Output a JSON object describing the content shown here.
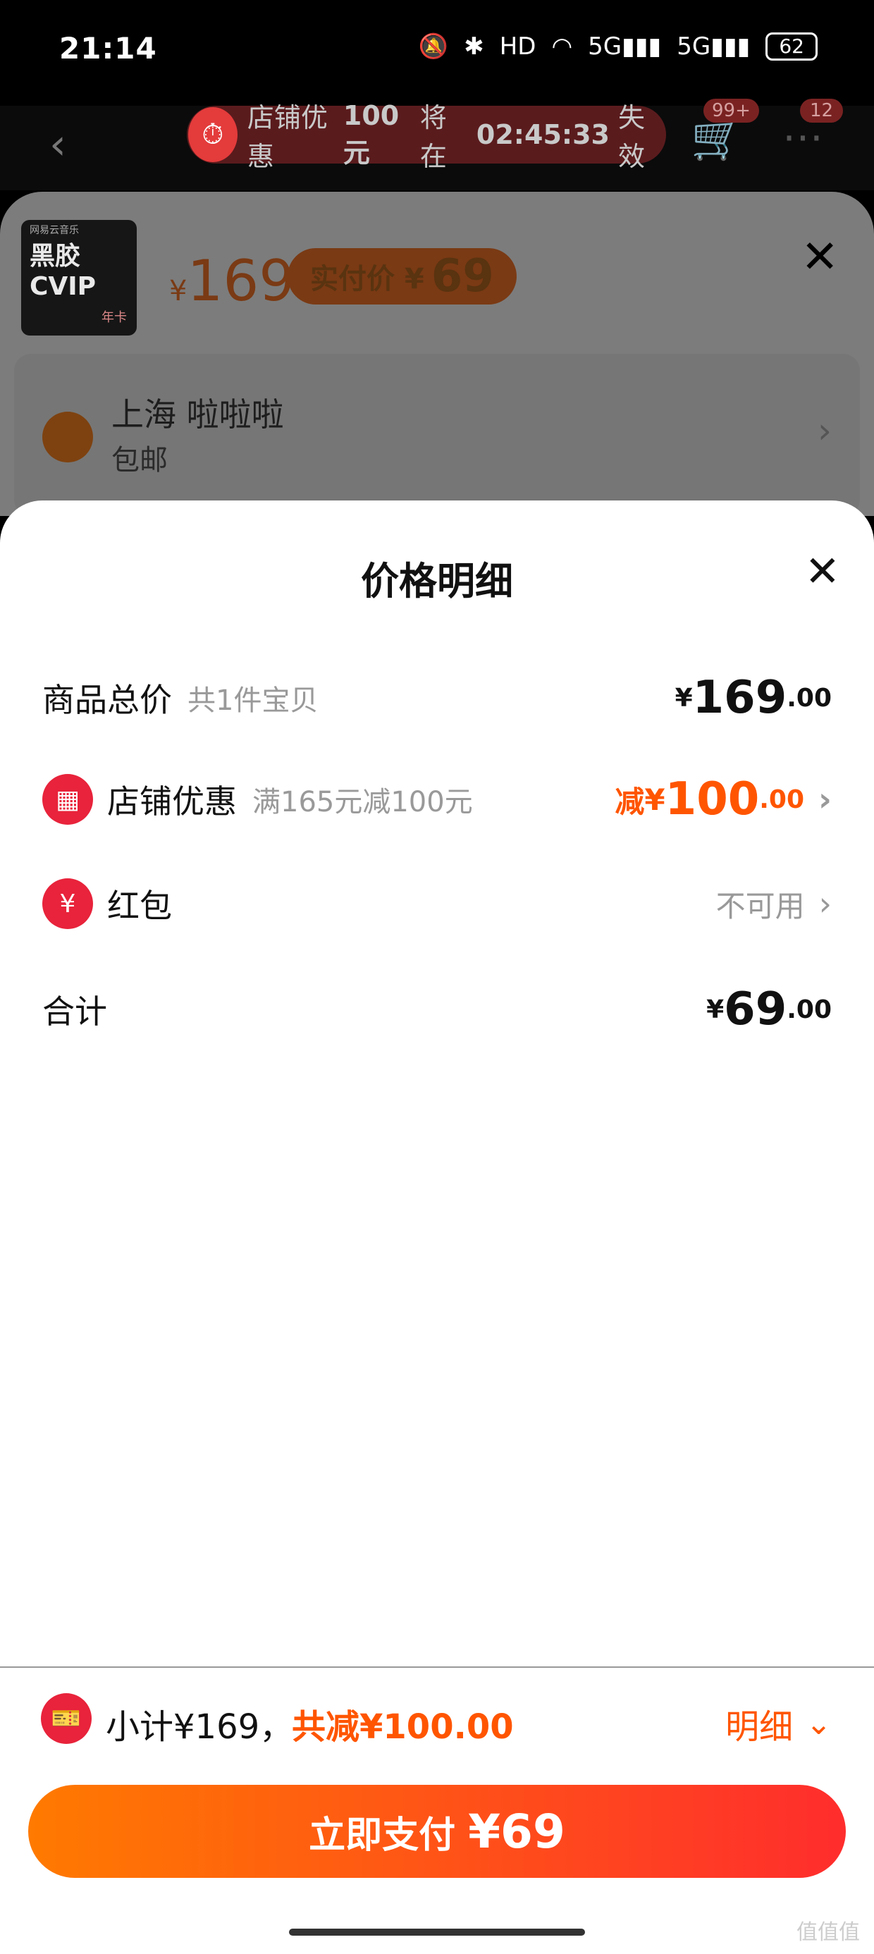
{
  "status_bar": {
    "time": "21:14",
    "battery": "62"
  },
  "top": {
    "coupon_prefix": "店铺优惠",
    "coupon_amount": "100元",
    "coupon_mid": "将在",
    "countdown": "02:45:33",
    "coupon_suffix": "失效",
    "cart_badge": "99+",
    "more_badge": "12"
  },
  "product": {
    "thumb_title": "黑胶CVIP",
    "thumb_tag": "网易云音乐",
    "thumb_year": "年卡",
    "price_symbol": "¥",
    "price": "169",
    "real_price_label": "实付价 ¥",
    "real_price": "69"
  },
  "address": {
    "name": "上海 啦啦啦",
    "shipping": "包邮"
  },
  "panel": {
    "title": "价格明细",
    "rows": {
      "goods": {
        "label": "商品总价",
        "sub": "共1件宝贝",
        "sym": "¥",
        "int": "169",
        "dec": ".00"
      },
      "store": {
        "label": "店铺优惠",
        "sub": "满165元减100元",
        "prefix": "减",
        "sym": "¥",
        "int": "100",
        "dec": ".00"
      },
      "redpack": {
        "label": "红包",
        "value": "不可用"
      },
      "total": {
        "label": "合计",
        "sym": "¥",
        "int": "69",
        "dec": ".00"
      }
    }
  },
  "footer": {
    "subtotal": "小计¥169，",
    "total_off": "共减¥100.00",
    "detail": "明细",
    "pay_label": "立即支付",
    "pay_amount": "¥69",
    "watermark": "值值值"
  },
  "colors": {
    "accent": "#ff5500",
    "red": "#e8233b",
    "pay_start": "#ff7a00",
    "pay_end": "#ff2d2d"
  }
}
